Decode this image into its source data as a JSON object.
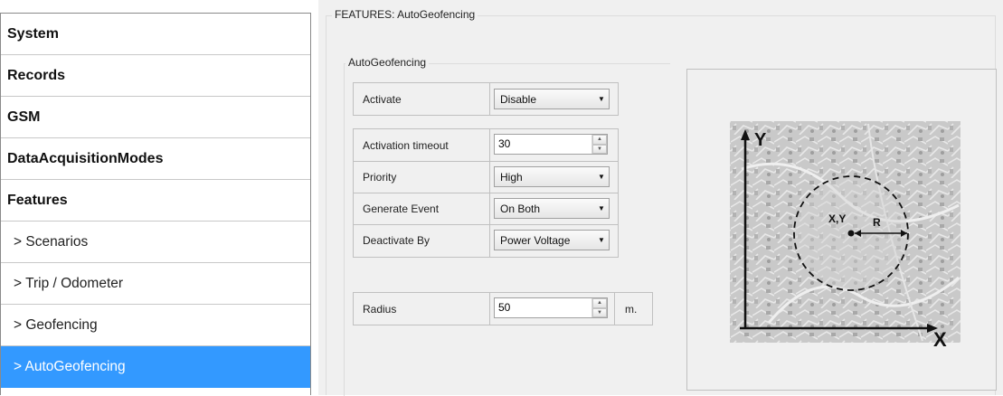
{
  "sidebar": {
    "items": [
      {
        "label": "System"
      },
      {
        "label": "Records"
      },
      {
        "label": "GSM"
      },
      {
        "label": "DataAcquisitionModes"
      },
      {
        "label": "Features"
      },
      {
        "label": "> Scenarios"
      },
      {
        "label": "> Trip / Odometer"
      },
      {
        "label": "> Geofencing"
      },
      {
        "label": "> AutoGeofencing"
      }
    ]
  },
  "panel": {
    "title": "FEATURES: AutoGeofencing",
    "group_title": "AutoGeofencing",
    "activate": {
      "label": "Activate",
      "value": "Disable"
    },
    "activation_timeout": {
      "label": "Activation timeout",
      "value": "30"
    },
    "priority": {
      "label": "Priority",
      "value": "High"
    },
    "generate_event": {
      "label": "Generate Event",
      "value": "On Both"
    },
    "deactivate_by": {
      "label": "Deactivate By",
      "value": "Power Voltage"
    },
    "radius": {
      "label": "Radius",
      "value": "50",
      "unit": "m."
    }
  },
  "illustration": {
    "axis_y": "Y",
    "axis_x": "X",
    "center_label": "X,Y",
    "radius_label": "R"
  }
}
